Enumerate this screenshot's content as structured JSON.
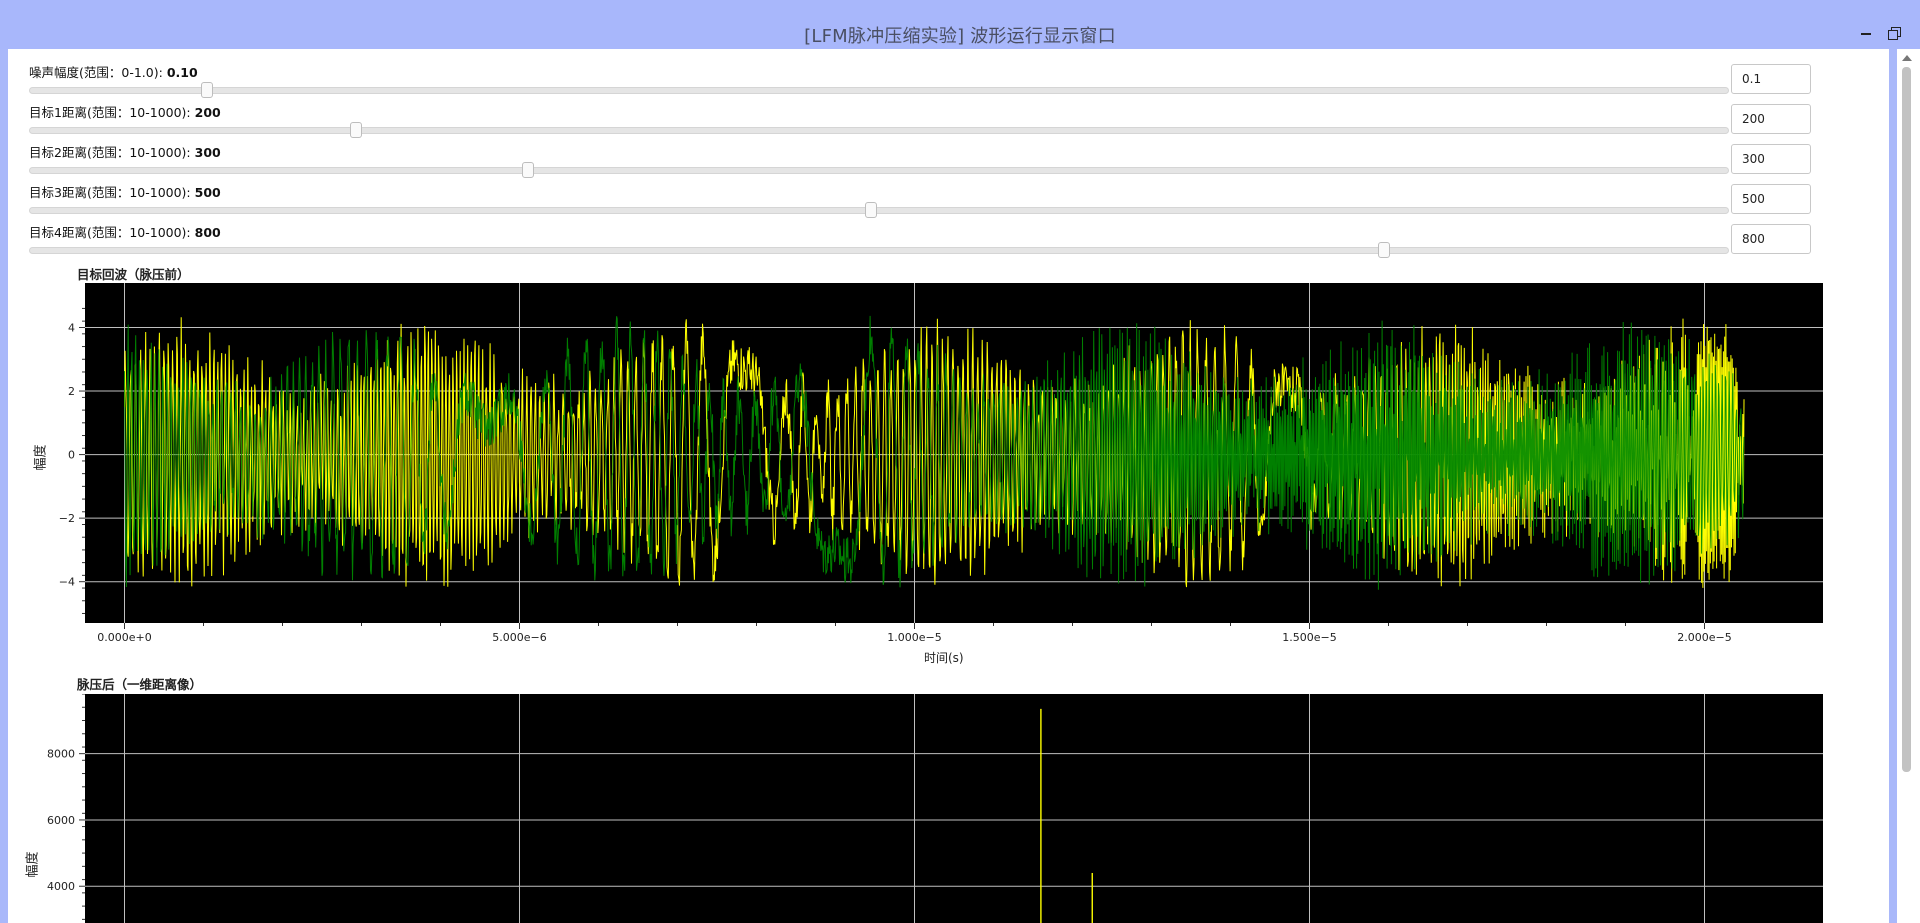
{
  "window": {
    "title": "[LFM脉冲压缩实验] 波形运行显示窗口",
    "minimize_icon": "minimize-icon",
    "restore_icon": "restore-icon"
  },
  "controls": [
    {
      "label": "噪声幅度(范围：0-1.0):",
      "value_text": "0.10",
      "input_value": "0.1",
      "fraction": 0.1
    },
    {
      "label": "目标1距离(范围：10-1000):",
      "value_text": "200",
      "input_value": "200",
      "fraction": 0.192
    },
    {
      "label": "目标2距离(范围：10-1000):",
      "value_text": "300",
      "input_value": "300",
      "fraction": 0.293
    },
    {
      "label": "目标3距离(范围：10-1000):",
      "value_text": "500",
      "input_value": "500",
      "fraction": 0.495
    },
    {
      "label": "目标4距离(范围：10-1000):",
      "value_text": "800",
      "input_value": "800",
      "fraction": 0.798
    }
  ],
  "chart_data": [
    {
      "type": "line",
      "title": "目标回波（脉压前）",
      "xlabel": "时间(s)",
      "ylabel": "幅度",
      "x_range": [
        -5e-07,
        2.15e-05
      ],
      "ylim": [
        -5.3,
        5.4
      ],
      "grid": true,
      "x_ticks": [
        0,
        5e-06,
        1e-05,
        1.5e-05,
        2e-05
      ],
      "x_tick_labels": [
        "0.000e+0",
        "5.000e−6",
        "1.000e−5",
        "1.500e−5",
        "2.000e−5"
      ],
      "y_ticks": [
        -4,
        -2,
        0,
        2,
        4
      ],
      "y_tick_labels": [
        "−4",
        "−2",
        "0",
        "2",
        "4"
      ],
      "series": [
        {
          "color": "#ffff00",
          "description_range": [
            0,
            2.05e-05
          ],
          "amplitude_approx": 4.5
        },
        {
          "color": "#008a00",
          "description_range": [
            0,
            2.05e-05
          ],
          "amplitude_approx": 4.5
        }
      ]
    },
    {
      "type": "line",
      "title": "脉压后（一维距离像）",
      "xlabel": "",
      "ylabel": "幅度",
      "x_range": [
        -5e-07,
        2.15e-05
      ],
      "ylim": [
        2800,
        9800
      ],
      "grid": true,
      "x_ticks": [
        0,
        5e-06,
        1e-05,
        1.5e-05,
        2e-05
      ],
      "y_ticks": [
        4000,
        6000,
        8000
      ],
      "y_tick_labels": [
        "4000",
        "6000",
        "8000"
      ],
      "series": [
        {
          "color": "#ffff00",
          "peaks": [
            {
              "x": 1.16e-05,
              "y": 9350
            },
            {
              "x": 1.225e-05,
              "y": 4400
            }
          ]
        }
      ]
    }
  ]
}
